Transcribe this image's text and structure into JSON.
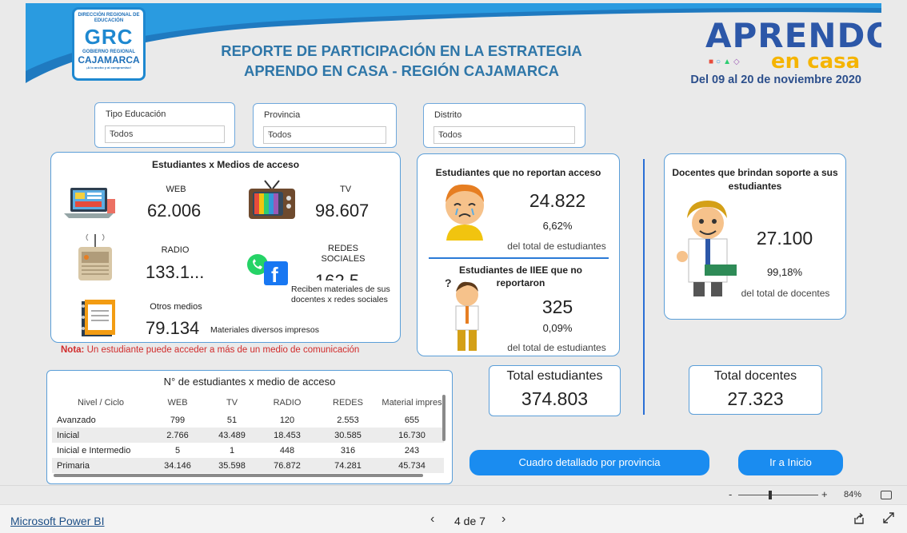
{
  "header": {
    "logo": {
      "line1": "DIRECCIÓN REGIONAL DE EDUCACIÓN",
      "mark": "GRC",
      "line2": "GOBIERNO REGIONAL",
      "line3": "CAJAMARCA",
      "tagline": "¡A lo ancho y al compromiso!"
    },
    "title_line1": "REPORTE DE PARTICIPACIÓN EN LA ESTRATEGIA",
    "title_line2": "APRENDO EN CASA - REGIÓN CAJAMARCA",
    "brand_line1": "APRENDO",
    "brand_line2": "en casa",
    "date_range": "Del 09  al 20 de noviembre 2020",
    "colors": {
      "title": "#2e76a8",
      "wave": "#1e88d0",
      "brand_blue": "#2c57a8",
      "brand_yellow": "#f5b400"
    }
  },
  "filters": [
    {
      "label": "Tipo Educación",
      "value": "Todos"
    },
    {
      "label": "Provincia",
      "value": "Todos"
    },
    {
      "label": "Distrito",
      "value": "Todos"
    }
  ],
  "media": {
    "title": "Estudiantes x Medios de acceso",
    "web": {
      "label": "WEB",
      "value": "62.006"
    },
    "tv": {
      "label": "TV",
      "value": "98.607"
    },
    "radio": {
      "label": "RADIO",
      "value": "133.1..."
    },
    "social": {
      "label": "REDES SOCIALES",
      "value": "162.5",
      "note": "Reciben materiales de sus docentes x redes sociales"
    },
    "other": {
      "label": "Otros medios",
      "value": "79.134",
      "note": "Materiales diversos impresos"
    }
  },
  "nota": {
    "prefix": "Nota:",
    "text": " Un estudiante puede acceder a más de un medio de comunicación"
  },
  "no_access": {
    "title": "Estudiantes  que no reportan acceso",
    "value": "24.822",
    "pct": "6,62%",
    "sub": "del total de estudiantes"
  },
  "iiee": {
    "title": "Estudiantes  de IIEE que no reportaron",
    "value": "325",
    "pct": "0,09%",
    "sub": "del total de estudiantes"
  },
  "teachers": {
    "title": "Docentes que brindan soporte a sus estudiantes",
    "value": "27.100",
    "pct": "99,18%",
    "sub": "del total de docentes"
  },
  "table": {
    "title": "N° de estudiantes x medio de acceso",
    "columns": [
      "Nivel / Ciclo",
      "WEB",
      "TV",
      "RADIO",
      "REDES",
      "Material impres"
    ],
    "rows": [
      [
        "Avanzado",
        "799",
        "51",
        "120",
        "2.553",
        "655"
      ],
      [
        "Inicial",
        "2.766",
        "43.489",
        "18.453",
        "30.585",
        "16.730"
      ],
      [
        "Inicial e Intermedio",
        "5",
        "1",
        "448",
        "316",
        "243"
      ],
      [
        "Primaria",
        "34.146",
        "35.598",
        "76.872",
        "74.281",
        "45.734"
      ]
    ]
  },
  "totals": {
    "students": {
      "label": "Total estudiantes",
      "value": "374.803"
    },
    "teachers": {
      "label": "Total docentes",
      "value": "27.323"
    }
  },
  "buttons": {
    "detail": "Cuadro detallado por provincia",
    "home": "Ir a Inicio"
  },
  "zoom": {
    "minus": "-",
    "plus": "+",
    "level": "84%"
  },
  "footer": {
    "brand": "Microsoft Power BI",
    "page": "4 de 7",
    "prev": "‹",
    "next": "›"
  }
}
